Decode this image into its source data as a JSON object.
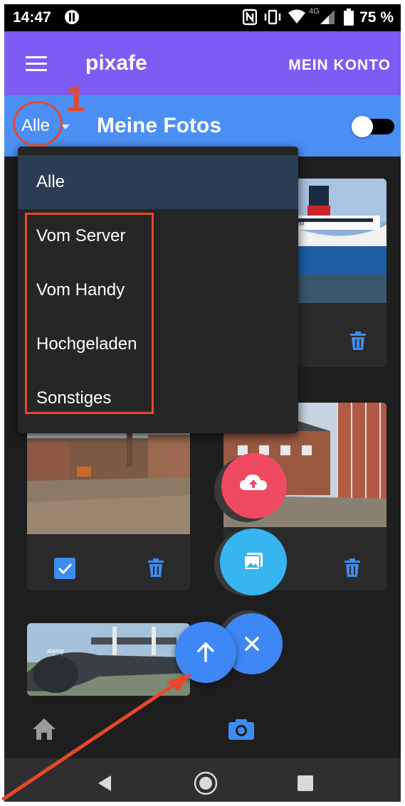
{
  "status_bar": {
    "time": "14:47",
    "network": "4G",
    "battery": "75 %"
  },
  "app_bar": {
    "title": "pixafe",
    "account_label": "MEIN KONTO",
    "menu_icon": "hamburger-menu-icon"
  },
  "sub_bar": {
    "filter_value": "Alle",
    "heading": "Meine Fotos",
    "toggle_on": false
  },
  "annotation": {
    "step_number": "1",
    "color": "#e8472c"
  },
  "dropdown": {
    "options": [
      "Alle",
      "Vom Server",
      "Vom Handy",
      "Hochgeladen",
      "Sonstiges"
    ],
    "selected": "Alle"
  },
  "cards": [
    {
      "image": "ferry-photo",
      "selected": false
    },
    {
      "image": "street-construction-photo",
      "selected": true
    },
    {
      "image": "building-construction-photo",
      "selected": false
    },
    {
      "image": "aircraft-photo",
      "watermark": "alamy"
    }
  ],
  "fabs": [
    "upload-cloud-icon",
    "image-gallery-icon",
    "close-icon",
    "arrow-up-icon"
  ],
  "bottom_nav": [
    "home-icon",
    "camera-icon"
  ],
  "system_nav": [
    "back-icon",
    "home-circle-icon",
    "recents-icon"
  ],
  "colors": {
    "primary": "#7c5cf4",
    "secondary": "#4b8ff5",
    "accent_blue": "#3d8cf0",
    "fab_red": "#ef4a61",
    "fab_cyan": "#37b5f0",
    "fab_blue": "#3f87f5"
  }
}
